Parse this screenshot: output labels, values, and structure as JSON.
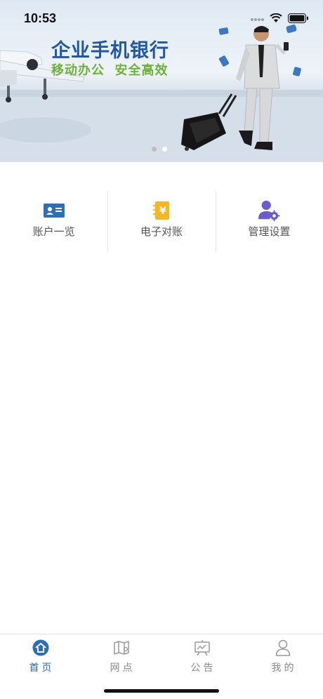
{
  "status_bar": {
    "time": "10:53"
  },
  "banner": {
    "title": "企业手机银行",
    "subtitle": "移动办公  安全高效",
    "slides": 2,
    "active_slide": 2
  },
  "quick_menu": [
    {
      "label": "账户一览",
      "icon": "account-card-icon"
    },
    {
      "label": "电子对账",
      "icon": "e-statement-icon"
    },
    {
      "label": "管理设置",
      "icon": "user-settings-icon"
    }
  ],
  "tab_bar": {
    "tabs": [
      {
        "label": "首页",
        "icon": "home-icon",
        "active": true
      },
      {
        "label": "网点",
        "icon": "map-icon",
        "active": false
      },
      {
        "label": "公告",
        "icon": "announcement-icon",
        "active": false
      },
      {
        "label": "我的",
        "icon": "person-icon",
        "active": false
      }
    ]
  },
  "colors": {
    "accent": "#2a6fb8",
    "banner_title": "#1e58a6",
    "banner_subtitle": "#6cb23b",
    "statement_icon": "#f5b71d",
    "settings_icon": "#6a5ccd",
    "inactive_text": "#888888"
  }
}
